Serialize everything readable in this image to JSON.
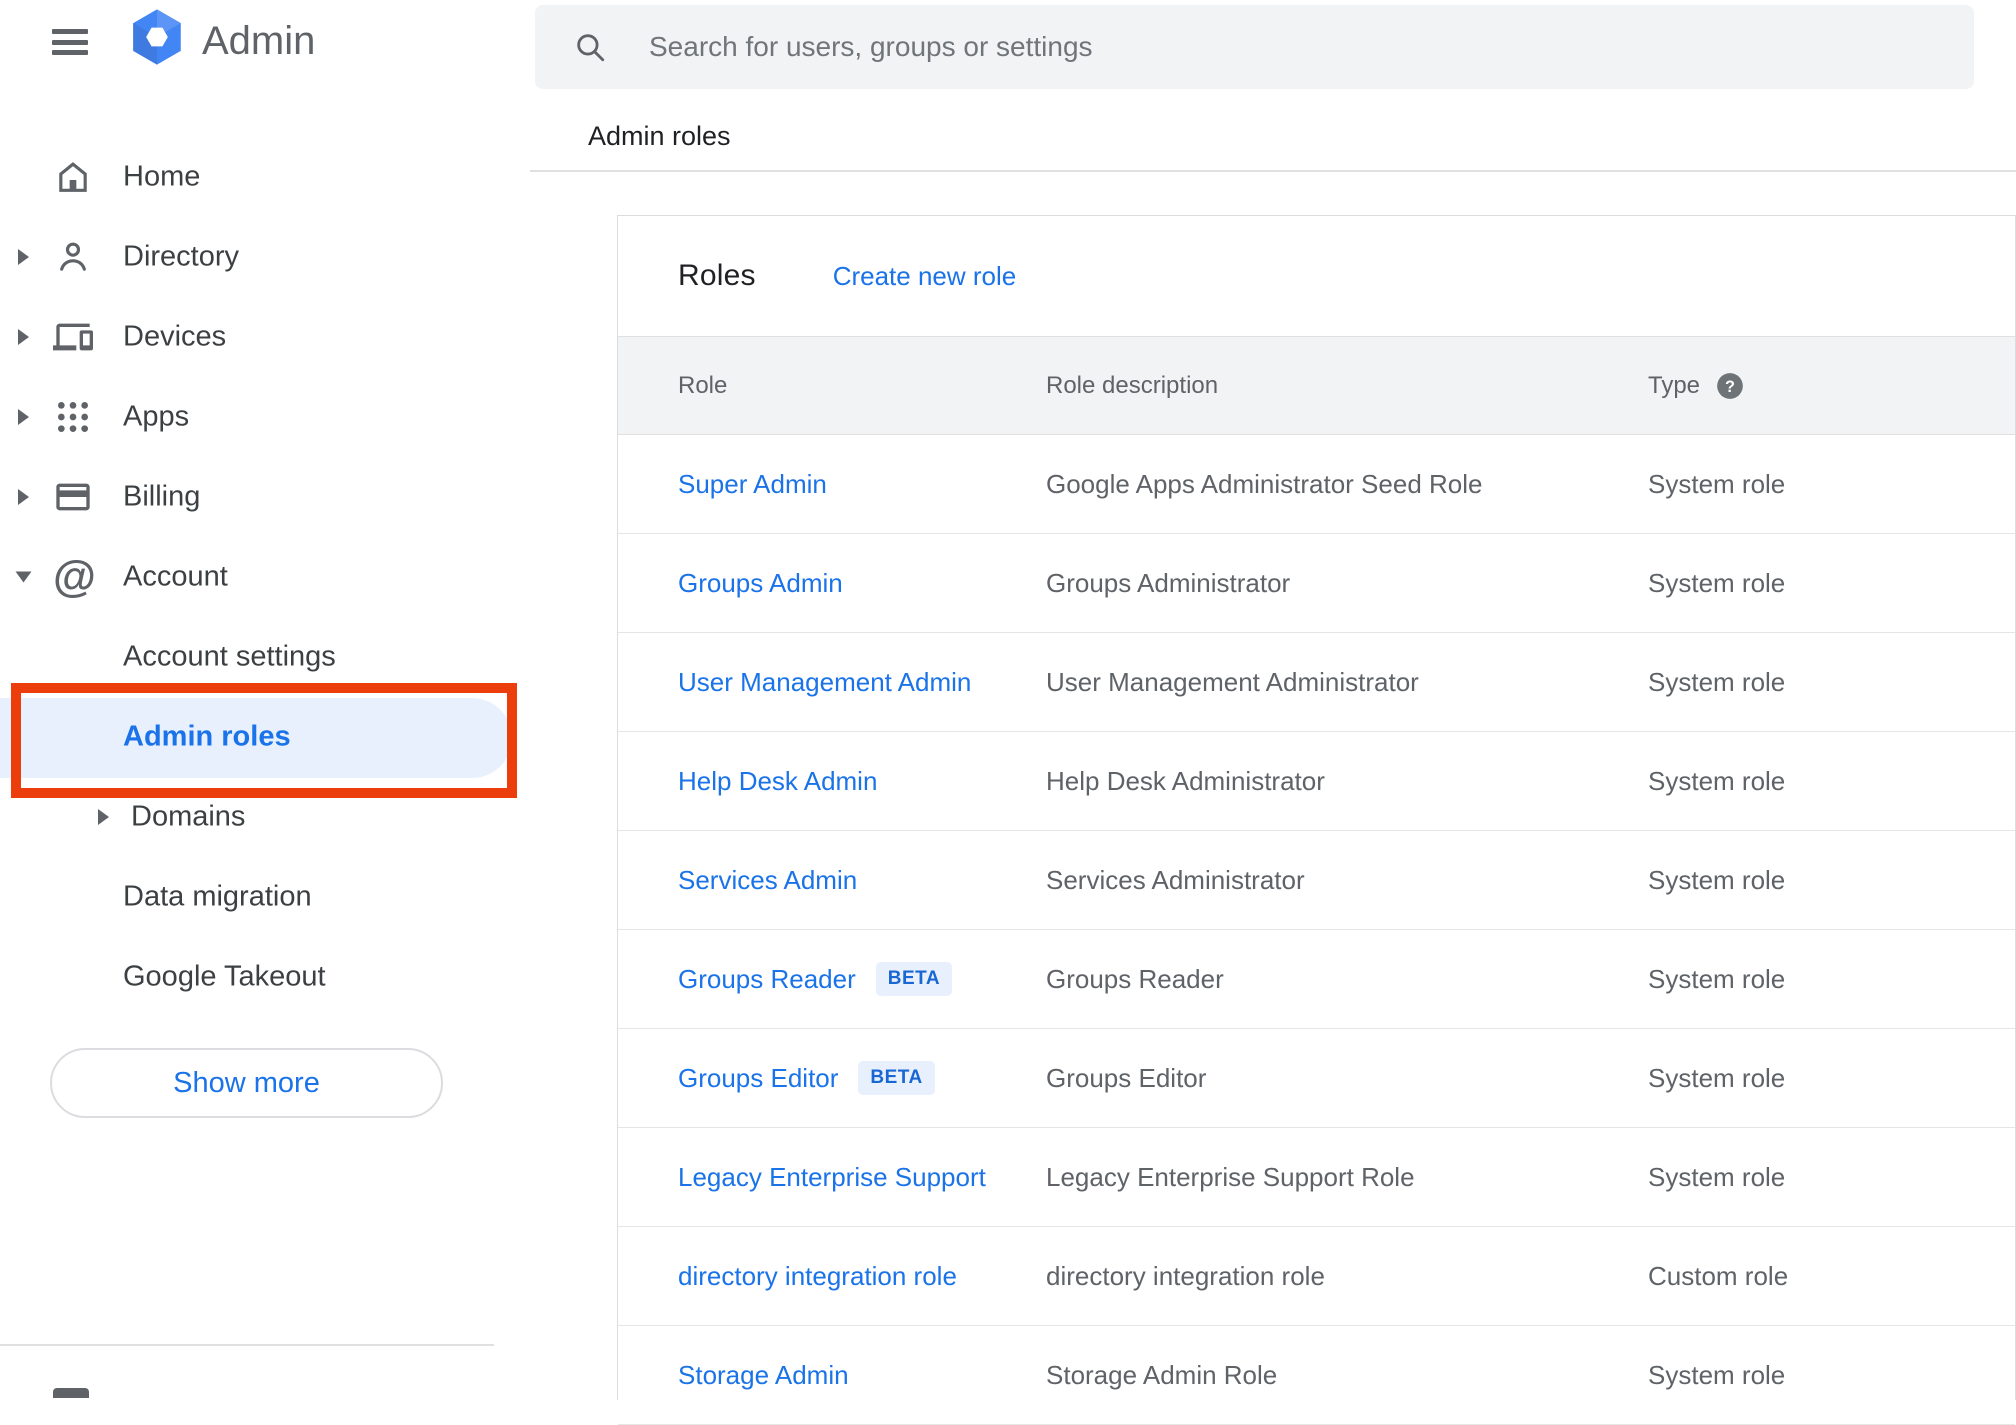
{
  "colors": {
    "accent_blue": "#1a73e8",
    "annotation_red": "#ec3e0d",
    "active_pill_bg": "#e8f0fe",
    "beta_badge_bg": "#e8f0fe",
    "beta_badge_text": "#1967d2",
    "table_header_bg": "#f1f3f4",
    "search_bg": "#f1f3f4",
    "text_primary": "#202124",
    "text_secondary": "#5f6368"
  },
  "header": {
    "app_title": "Admin",
    "search_placeholder": "Search for users, groups or settings"
  },
  "sidebar": {
    "items": [
      {
        "label": "Home"
      },
      {
        "label": "Directory"
      },
      {
        "label": "Devices"
      },
      {
        "label": "Apps"
      },
      {
        "label": "Billing"
      },
      {
        "label": "Account"
      },
      {
        "label": "Account settings"
      },
      {
        "label": "Admin roles"
      },
      {
        "label": "Domains"
      },
      {
        "label": "Data migration"
      },
      {
        "label": "Google Takeout"
      }
    ],
    "show_more_label": "Show more"
  },
  "breadcrumb": "Admin roles",
  "main": {
    "card_title": "Roles",
    "create_link": "Create new role",
    "table": {
      "columns": [
        "Role",
        "Role description",
        "Type"
      ],
      "rows": [
        {
          "role": "Super Admin",
          "badge": "",
          "description": "Google Apps Administrator Seed Role",
          "type": "System role"
        },
        {
          "role": "Groups Admin",
          "badge": "",
          "description": "Groups Administrator",
          "type": "System role"
        },
        {
          "role": "User Management Admin",
          "badge": "",
          "description": "User Management Administrator",
          "type": "System role"
        },
        {
          "role": "Help Desk Admin",
          "badge": "",
          "description": "Help Desk Administrator",
          "type": "System role"
        },
        {
          "role": "Services Admin",
          "badge": "",
          "description": "Services Administrator",
          "type": "System role"
        },
        {
          "role": "Groups Reader",
          "badge": "BETA",
          "description": "Groups Reader",
          "type": "System role"
        },
        {
          "role": "Groups Editor",
          "badge": "BETA",
          "description": "Groups Editor",
          "type": "System role"
        },
        {
          "role": "Legacy Enterprise Support",
          "badge": "",
          "description": "Legacy Enterprise Support Role",
          "type": "System role"
        },
        {
          "role": "directory integration role",
          "badge": "",
          "description": "directory integration role",
          "type": "Custom role"
        },
        {
          "role": "Storage Admin",
          "badge": "",
          "description": "Storage Admin Role",
          "type": "System role"
        }
      ]
    }
  }
}
